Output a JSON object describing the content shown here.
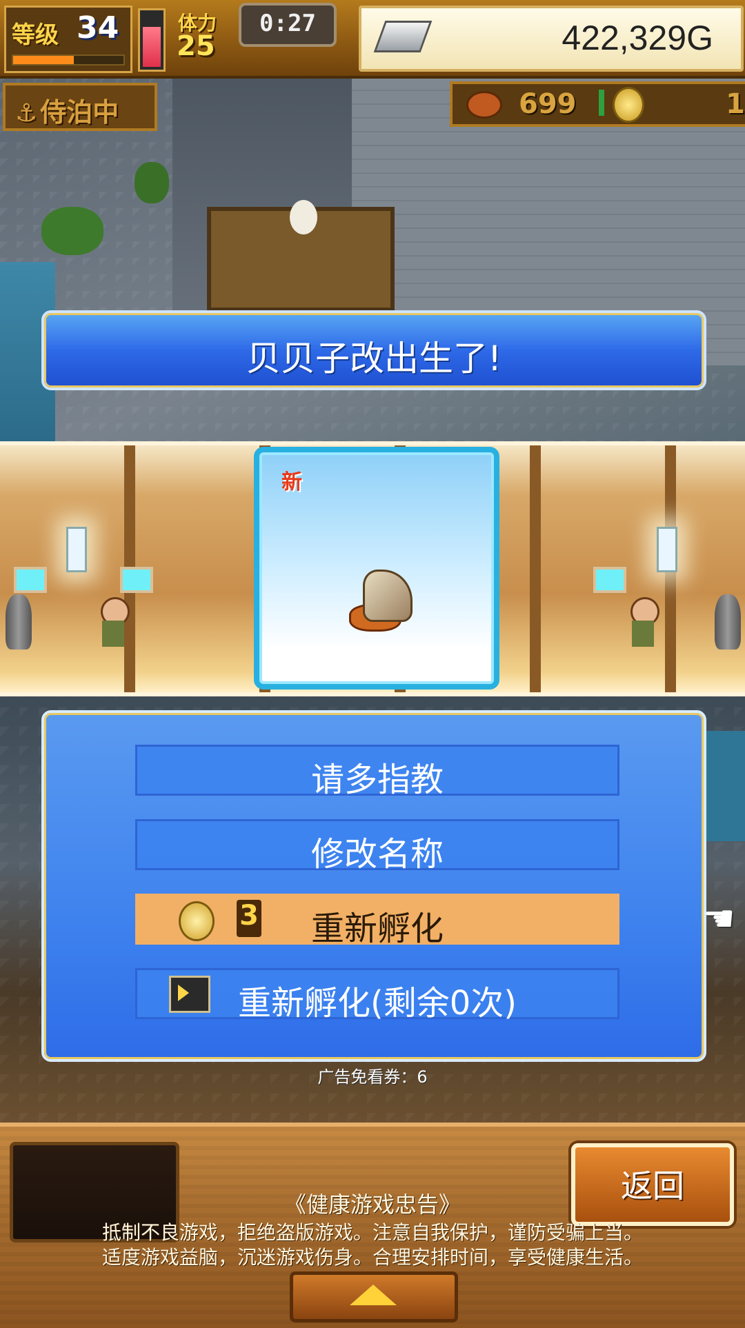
{
  "hud": {
    "level_label": "等级",
    "level_value": "34",
    "level_progress": 0.55,
    "stamina_label": "体力",
    "stamina_value": "25",
    "stamina_fill": 0.75,
    "timer": "0:27",
    "gold": "422,329G",
    "dock_status": "侍泊中",
    "food": "699",
    "coins": "1"
  },
  "banner": {
    "text": "贝贝子改出生了!"
  },
  "card": {
    "new_tag": "新"
  },
  "menu": {
    "option1": "请多指教",
    "option2": "修改名称",
    "option3": {
      "cost": "3",
      "label": "重新孵化"
    },
    "option4": "重新孵化(剩余0次)"
  },
  "ad_ticket": "广告免看券：6",
  "footer": {
    "back_label": "返回",
    "notice_title": "《健康游戏忠告》",
    "notice_line1": "抵制不良游戏，拒绝盗版游戏。注意自我保护，谨防受骗上当。",
    "notice_line2": "适度游戏益脑，沉迷游戏伤身。合理安排时间，享受健康生活。"
  },
  "colors": {
    "accent_blue": "#2e6ae8",
    "highlight": "#f2b066",
    "wood": "#a86e30"
  },
  "icons": [
    "anchor-icon",
    "silver-bar-icon",
    "meat-icon",
    "coin-icon",
    "hand-pointer-icon",
    "video-icon",
    "up-arrow-icon"
  ]
}
